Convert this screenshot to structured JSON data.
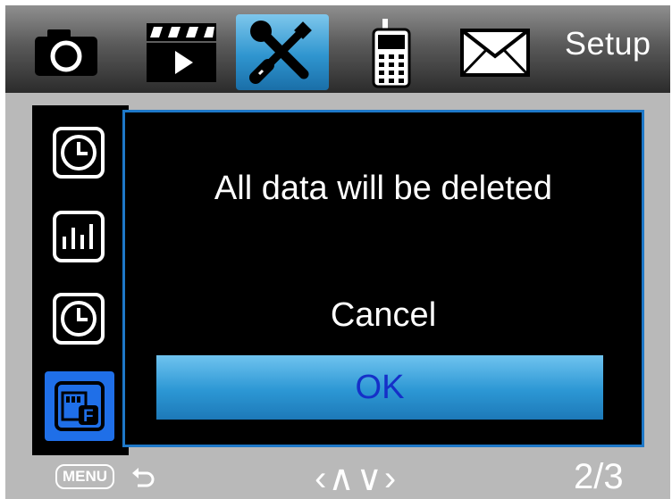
{
  "header": {
    "tabs": [
      {
        "id": "photo",
        "icon": "camera-icon",
        "active": false
      },
      {
        "id": "video",
        "icon": "clapperboard-icon",
        "active": false
      },
      {
        "id": "setup",
        "icon": "wrench-screwdriver-icon",
        "active": true
      },
      {
        "id": "cellular",
        "icon": "cellphone-icon",
        "active": false
      },
      {
        "id": "message",
        "icon": "envelope-icon",
        "active": false
      }
    ],
    "section_title": "Setup"
  },
  "sidebar": {
    "items": [
      {
        "icon": "clock-icon",
        "active": false
      },
      {
        "icon": "bar-chart-icon",
        "active": false
      },
      {
        "icon": "clock-icon",
        "active": false
      },
      {
        "icon": "format-sd-card-icon",
        "active": true
      }
    ]
  },
  "dialog": {
    "message": "All data will be deleted",
    "options": [
      {
        "label": "Cancel",
        "selected": false
      },
      {
        "label": "OK",
        "selected": true
      }
    ]
  },
  "footer": {
    "menu_key": "MENU",
    "nav_hint": "<^v>",
    "nav_arrows": "‹∧∨›",
    "page": "2/3"
  },
  "colors": {
    "accent": "#2c97d4",
    "dialog_border": "#1e78c8",
    "selected_text": "#1530c8",
    "sidebar_active": "#1f6fe8"
  }
}
